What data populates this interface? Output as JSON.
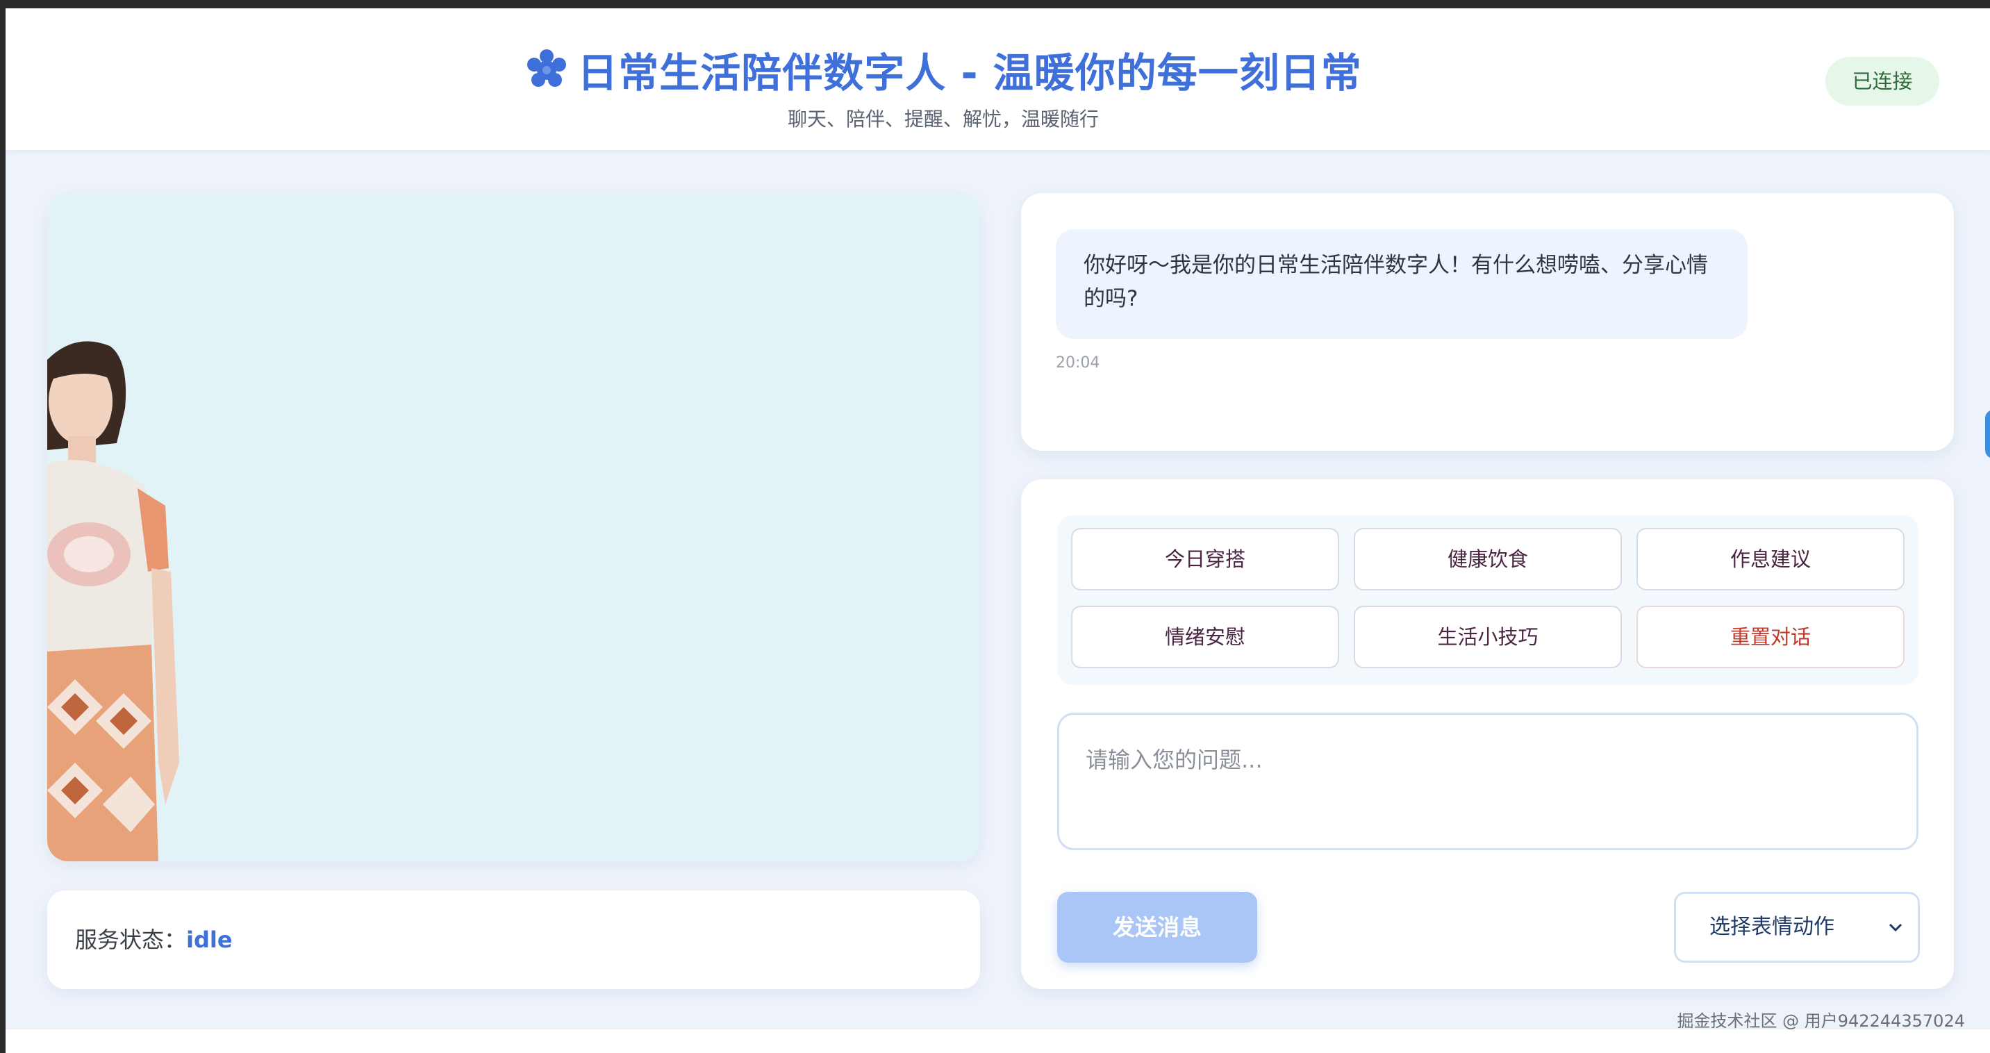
{
  "header": {
    "title": "日常生活陪伴数字人 - 温暖你的每一刻日常",
    "subtitle": "聊天、陪伴、提醒、解忧，温暖随行",
    "connection_status": "已连接"
  },
  "avatar": {
    "status_label": "服务状态：",
    "status_value": "idle"
  },
  "chat": {
    "messages": [
      {
        "text": "你好呀～我是你的日常生活陪伴数字人！有什么想唠嗑、分享心情的吗?",
        "time": "20:04"
      }
    ]
  },
  "quick_actions": [
    {
      "label": "今日穿搭"
    },
    {
      "label": "健康饮食"
    },
    {
      "label": "作息建议"
    },
    {
      "label": "情绪安慰"
    },
    {
      "label": "生活小技巧"
    },
    {
      "label": "重置对话"
    }
  ],
  "input": {
    "placeholder": "请输入您的问题...",
    "value": ""
  },
  "send_button": {
    "label": "发送消息"
  },
  "emote_select": {
    "selected": "选择表情动作"
  },
  "watermark": "掘金技术社区 @ 用户942244357024",
  "colors": {
    "accent": "#3f6fd8",
    "connected_bg": "#e6f7ea",
    "avatar_bg": "#e2f3f8",
    "send_button": "#a9c6f6",
    "reset_text": "#c0392b"
  }
}
